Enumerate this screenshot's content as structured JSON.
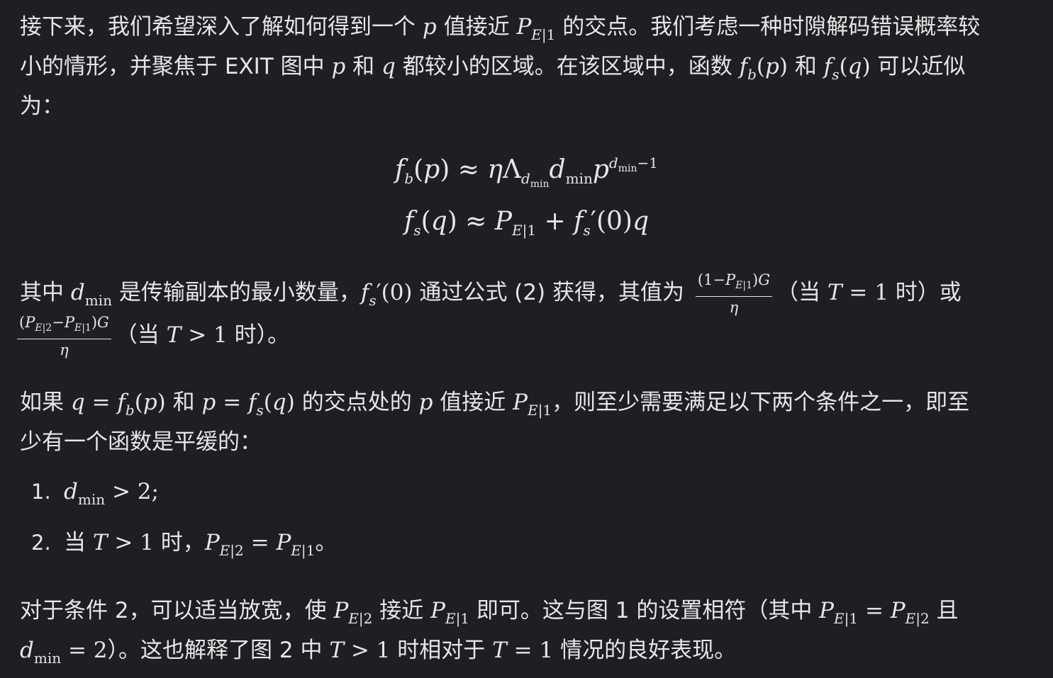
{
  "paragraph1": {
    "line1_pre": "接下来，我们希望深入了解如何得到一个 ",
    "line1_mid": " 值接近 ",
    "line1_post": " 的交点。我们考虑一种时隙解码错误概率较",
    "line2_pre": "小的情形，并聚焦于 EXIT 图中 ",
    "line2_and": " 和 ",
    "line2_mid": " 都较小的区域。在该区域中，函数 ",
    "line2_and2": " 和 ",
    "line2_post": " 可以近似",
    "line3": "为："
  },
  "equations": {
    "eq1": "f_b(p) ≈ η Λ_{d_min} d_min p^{d_min − 1}",
    "eq2": "f_s(q) ≈ P_{E|1} + f_s′(0) q"
  },
  "paragraph2": {
    "line1_pre": "其中 ",
    "line1_mid": " 是传输副本的最小数量，",
    "line1_mid2": " 通过公式 (2) 获得，其值为 ",
    "line1_mid3": "（当 ",
    "line1_post": " 时）或",
    "line2_mid": "（当 ",
    "line2_post": " 时）。"
  },
  "paragraph3": {
    "line1_pre": "如果 ",
    "line1_and": " 和 ",
    "line1_mid": " 的交点处的 ",
    "line1_mid2": " 值接近 ",
    "line1_post": "，则至少需要满足以下两个条件之一，即至",
    "line2": "少有一个函数是平缓的："
  },
  "list": {
    "item1_label": "1.",
    "item2_label": "2.",
    "item2_pre": "当 ",
    "item2_mid": " 时，",
    "item2_post": "。"
  },
  "paragraph4": {
    "line1_pre": "对于条件 2，可以适当放宽，使 ",
    "line1_mid": " 接近 ",
    "line1_mid2": " 即可。这与图 1 的设置相符（其中 ",
    "line1_post": " 且",
    "line2_mid": "）。这也解释了图 2 中 ",
    "line2_mid2": " 时相对于 ",
    "line2_post": " 情况的良好表现。"
  },
  "colors": {
    "background": "#1e1f23",
    "text": "#e6e6e6"
  }
}
